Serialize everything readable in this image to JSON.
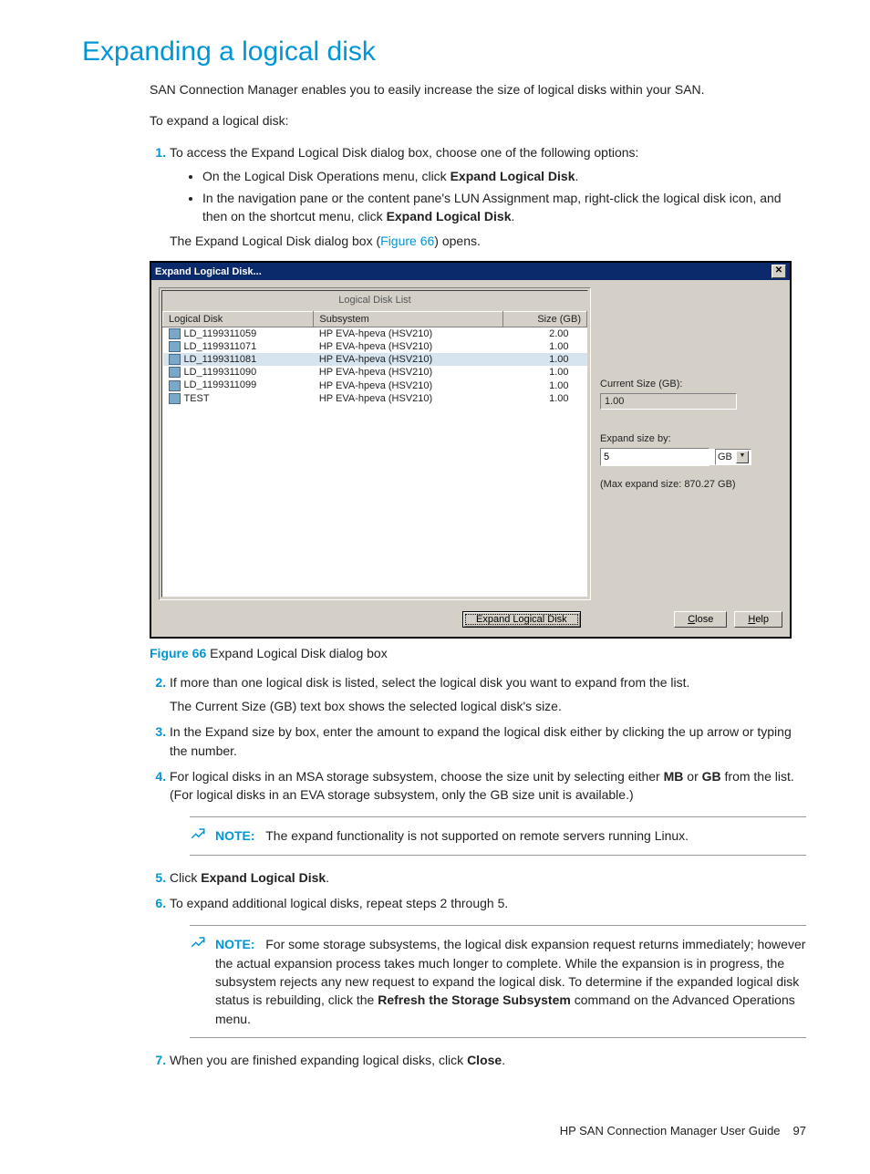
{
  "title": "Expanding a logical disk",
  "intro1": "SAN Connection Manager enables you to easily increase the size of logical disks within your SAN.",
  "intro2": "To expand a logical disk:",
  "step1_lead": "To access the Expand Logical Disk dialog box, choose one of the following options:",
  "step1_b1a": "On the Logical Disk Operations menu, click ",
  "step1_b1b": "Expand Logical Disk",
  "step1_b2a": "In the navigation pane or the content pane's LUN Assignment map, right-click the logical disk icon, and then on the shortcut menu, click ",
  "step1_b2b": "Expand Logical Disk",
  "step1_after_a": "The Expand Logical Disk dialog box (",
  "step1_after_link": "Figure 66",
  "step1_after_b": ") opens.",
  "dialog": {
    "title": "Expand Logical Disk...",
    "list_title": "Logical Disk List",
    "col_disk": "Logical Disk",
    "col_subsys": "Subsystem",
    "col_size": "Size (GB)",
    "rows": [
      {
        "name": "LD_1199311059",
        "sub": "HP EVA-hpeva (HSV210)",
        "size": "2.00"
      },
      {
        "name": "LD_1199311071",
        "sub": "HP EVA-hpeva (HSV210)",
        "size": "1.00"
      },
      {
        "name": "LD_1199311081",
        "sub": "HP EVA-hpeva (HSV210)",
        "size": "1.00"
      },
      {
        "name": "LD_1199311090",
        "sub": "HP EVA-hpeva (HSV210)",
        "size": "1.00"
      },
      {
        "name": "LD_1199311099",
        "sub": "HP EVA-hpeva (HSV210)",
        "size": "1.00"
      },
      {
        "name": "TEST",
        "sub": "HP EVA-hpeva (HSV210)",
        "size": "1.00"
      }
    ],
    "sel_index": 2,
    "current_label": "Current Size (GB):",
    "current_value": "1.00",
    "expand_label": "Expand size by:",
    "expand_value": "5",
    "unit": "GB",
    "max_note": "(Max expand size: 870.27 GB)",
    "btn_expand": "Expand Logical Disk",
    "btn_close": "Close",
    "btn_help": "Help"
  },
  "fig_num": "Figure 66",
  "fig_cap": " Expand Logical Disk dialog box",
  "step2a": "If more than one logical disk is listed, select the logical disk you want to expand from the list.",
  "step2b": "The Current Size (GB) text box shows the selected logical disk's size.",
  "step3": "In the Expand size by box, enter the amount to expand the logical disk either by clicking the up arrow or typing the number.",
  "step4a": "For logical disks in an MSA storage subsystem, choose the size unit by selecting either ",
  "step4mb": "MB",
  "step4or": " or ",
  "step4gb": "GB",
  "step4b": " from the list. (For logical disks in an EVA storage subsystem, only the GB size unit is available.)",
  "note1_label": "NOTE:",
  "note1_text": "The expand functionality is not supported on remote servers running Linux.",
  "step5a": "Click ",
  "step5b": "Expand Logical Disk",
  "step6": "To expand additional logical disks, repeat steps 2 through 5.",
  "note2_label": "NOTE:",
  "note2a": "For some storage subsystems, the logical disk expansion request returns immediately; however the actual expansion process takes much longer to complete. While the expansion is in progress, the subsystem rejects any new request to expand the logical disk. To determine if the expanded logical disk status is rebuilding, click the ",
  "note2b": "Refresh the Storage Subsystem",
  "note2c": " command on the Advanced Operations menu.",
  "step7a": "When you are finished expanding logical disks, click ",
  "step7b": "Close",
  "footer_text": "HP SAN Connection Manager User Guide",
  "page_num": "97"
}
